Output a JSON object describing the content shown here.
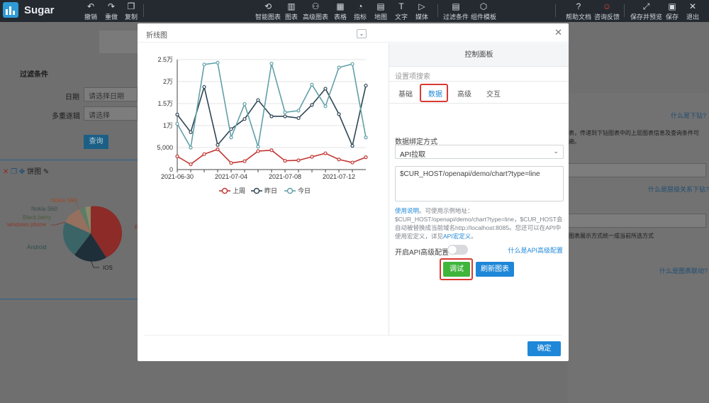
{
  "toolbar": {
    "brand": "Sugar",
    "items": [
      {
        "label": "撤销",
        "icon": "undo-icon",
        "glyph": "↶"
      },
      {
        "label": "重做",
        "icon": "redo-icon",
        "glyph": "↷"
      },
      {
        "label": "复制",
        "icon": "copy-icon",
        "glyph": "❐"
      },
      {
        "label": "智能图表",
        "icon": "smart-chart-icon",
        "glyph": "⟲"
      },
      {
        "label": "图表",
        "icon": "bar-chart-icon",
        "glyph": "▥"
      },
      {
        "label": "高级图表",
        "icon": "advanced-chart-icon",
        "glyph": "⚇"
      },
      {
        "label": "表格",
        "icon": "table-icon",
        "glyph": "▦"
      },
      {
        "label": "指标",
        "icon": "gauge-icon",
        "glyph": "◔"
      },
      {
        "label": "地图",
        "icon": "map-icon",
        "glyph": "▤"
      },
      {
        "label": "文字",
        "icon": "text-icon",
        "glyph": "T"
      },
      {
        "label": "媒体",
        "icon": "media-icon",
        "glyph": "▷"
      },
      {
        "label": "过滤条件",
        "icon": "filter-icon",
        "glyph": "▤"
      },
      {
        "label": "组件模板",
        "icon": "template-icon",
        "glyph": "⬡"
      },
      {
        "label": "帮助文档",
        "icon": "help-icon",
        "glyph": "?"
      },
      {
        "label": "咨询反馈",
        "icon": "feedback-icon",
        "glyph": "☺"
      },
      {
        "label": "保存并预览",
        "icon": "save-preview-icon",
        "glyph": "⤢"
      },
      {
        "label": "保存",
        "icon": "save-icon",
        "glyph": "▣"
      },
      {
        "label": "退出",
        "icon": "exit-icon",
        "glyph": "✕"
      }
    ]
  },
  "background": {
    "filter_title": "过滤条件",
    "date_label": "日期",
    "date_placeholder": "请选择日期",
    "cascade_label": "多重逐辑",
    "cascade_placeholder": "请选择",
    "query_button": "查询",
    "pie_title": "饼图",
    "pie_labels": [
      "Nokia S90",
      "Nokia S60",
      "Black berry",
      "windows phone",
      "Android",
      "IOS",
      "F"
    ],
    "right_links": [
      "什么是下钻?",
      "什么是层级关系下钻?",
      "什么是图表联动?"
    ],
    "right_texts": [
      "表，传递到下钻图表中的上层图表信息及查询条件可",
      "遍。",
      "图表展示方式统一成当前所选方式"
    ]
  },
  "modal": {
    "title": "折线图",
    "control_panel_title": "控制面板",
    "search_placeholder": "设置项搜索",
    "tabs": [
      "基础",
      "数据",
      "高级",
      "交互"
    ],
    "active_tab": "数据",
    "binding_label": "数据绑定方式",
    "binding_value": "API拉取",
    "api_url": "$CUR_HOST/openapi/demo/chart?type=line",
    "help_link": "使用说明",
    "help_text": "。可使用示例地址：$CUR_HOST/openapi/demo/chart?type=line，$CUR_HOST会自动被替换成当前域名http://localhost:8085。您还可以在API中使用宏定义，详见",
    "help_macro_link": "API宏定义",
    "help_end": "。",
    "advanced_label": "开启API高级配置",
    "advanced_link": "什么是API高级配置",
    "debug_button": "调试",
    "refresh_button": "刷新图表",
    "ok_button": "确定"
  },
  "chart_data": {
    "type": "line",
    "x": [
      "2021-06-30",
      "2021-07-01",
      "2021-07-02",
      "2021-07-03",
      "2021-07-04",
      "2021-07-05",
      "2021-07-06",
      "2021-07-07",
      "2021-07-08",
      "2021-07-09",
      "2021-07-10",
      "2021-07-11",
      "2021-07-12",
      "2021-07-13"
    ],
    "xticks": [
      "2021-06-30",
      "2021-07-04",
      "2021-07-08",
      "2021-07-12"
    ],
    "yticks": [
      "0",
      "5,000",
      "1万",
      "1.5万",
      "2万",
      "2.5万"
    ],
    "ylim": [
      0,
      25000
    ],
    "series": [
      {
        "name": "上周",
        "color": "#c23531",
        "values": [
          3000,
          1200,
          3500,
          4600,
          1500,
          1900,
          4200,
          4400,
          2000,
          2100,
          2900,
          3700,
          2300,
          1600,
          2800
        ]
      },
      {
        "name": "昨日",
        "color": "#2f4554",
        "values": [
          12500,
          8500,
          18800,
          5600,
          9200,
          11500,
          15800,
          12100,
          12100,
          11700,
          14700,
          18400,
          12600,
          5400,
          19100
        ]
      },
      {
        "name": "今日",
        "color": "#61a0a8",
        "values": [
          10400,
          5000,
          23900,
          24300,
          7300,
          14900,
          5200,
          24100,
          13000,
          13400,
          19300,
          14400,
          23200,
          24000,
          7300
        ]
      }
    ],
    "grid": true,
    "legend_position": "bottom"
  }
}
